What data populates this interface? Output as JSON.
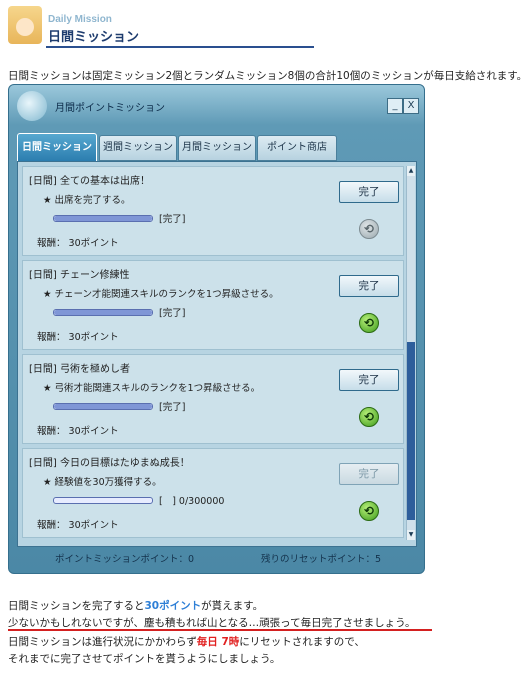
{
  "header": {
    "subtitle": "Daily Mission",
    "title": "日間ミッション"
  },
  "intro": "日間ミッションは固定ミッション2個とランダムミッション8個の合計10個のミッションが毎日支給されます。",
  "window": {
    "title": "月間ポイントミッション",
    "minimize": "_",
    "close": "X",
    "tabs": [
      "日間ミッション",
      "週間ミッション",
      "月間ミッション",
      "ポイント商店"
    ],
    "missions": [
      {
        "title": "[日間] 全ての基本は出席！",
        "desc": "★ 出席を完了する。",
        "progress_label": "[完了]",
        "progress": 1.0,
        "reward": "報酬： 30ポイント",
        "button": "完了",
        "button_enabled": true,
        "refresh_enabled": false
      },
      {
        "title": "[日間] チェーン修練性",
        "desc": "★ チェーン才能関連スキルのランクを1つ昇級させる。",
        "progress_label": "[完了]",
        "progress": 1.0,
        "reward": "報酬： 30ポイント",
        "button": "完了",
        "button_enabled": true,
        "refresh_enabled": true
      },
      {
        "title": "[日間] 弓術を極めし者",
        "desc": "★ 弓術才能関連スキルのランクを1つ昇級させる。",
        "progress_label": "[完了]",
        "progress": 1.0,
        "reward": "報酬： 30ポイント",
        "button": "完了",
        "button_enabled": true,
        "refresh_enabled": true
      },
      {
        "title": "[日間] 今日の目標はたゆまぬ成長！",
        "desc": "★ 経験値を30万獲得する。",
        "progress_label": "[　] 0/300000",
        "progress": 0.0,
        "reward": "報酬： 30ポイント",
        "button": "完了",
        "button_enabled": false,
        "refresh_enabled": true
      }
    ],
    "footer_left": "ポイントミッションポイント：0",
    "footer_right": "残りのリセットポイント：5"
  },
  "notes": {
    "line1_pre": "日間ミッションを完了すると",
    "line1_hl": "30ポイント",
    "line1_post": "が貰えます。",
    "line2": "少ないかもしれないですが、塵も積もれば山となる…頑張って毎日完了させましょう。",
    "line3_pre": "日間ミッションは進行状況にかかわらず",
    "line3_hl": "毎日 7時",
    "line3_post": "にリセットされますので、",
    "line4": "それまでに完了させてポイントを貰うようにしましょう。"
  },
  "colors": {
    "accent": "#2e7fd6",
    "warning": "#e12020",
    "header_line": "#2a4f8f"
  }
}
